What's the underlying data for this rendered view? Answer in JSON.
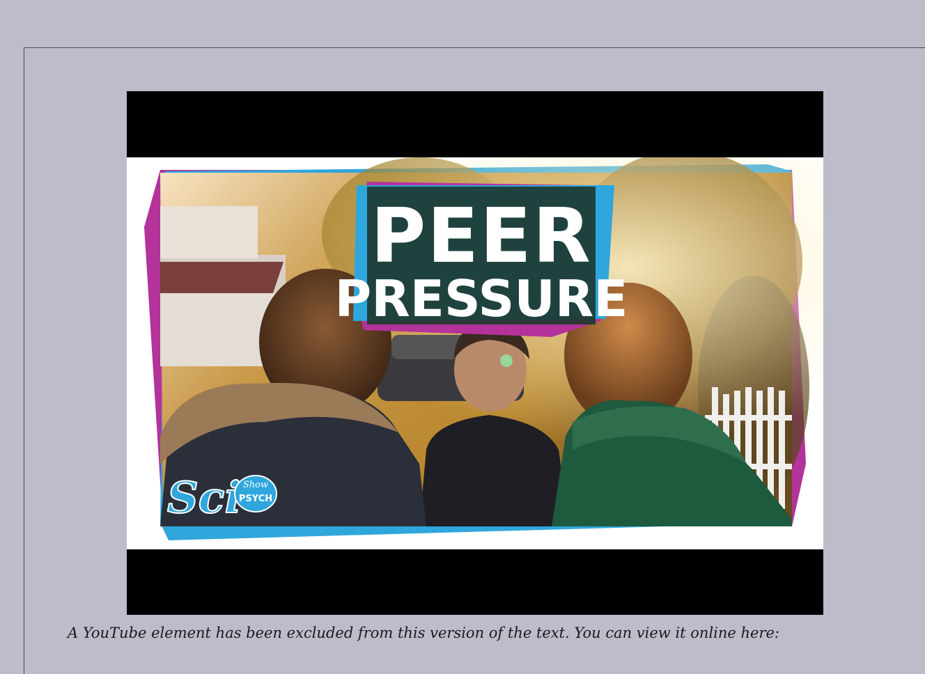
{
  "video": {
    "thumbnail_title_line1": "PEER",
    "thumbnail_title_line2": "PRESSURE",
    "channel_logo_main": "Sci",
    "channel_logo_sub_top": "Show",
    "channel_logo_sub_bottom": "PSYCH",
    "frame_colors": {
      "cyan": "#2fa6dc",
      "magenta": "#b3339a",
      "letterbox": "#000000"
    }
  },
  "caption": {
    "text": "A YouTube element has been excluded from this version of the text. You can view it online here:"
  }
}
